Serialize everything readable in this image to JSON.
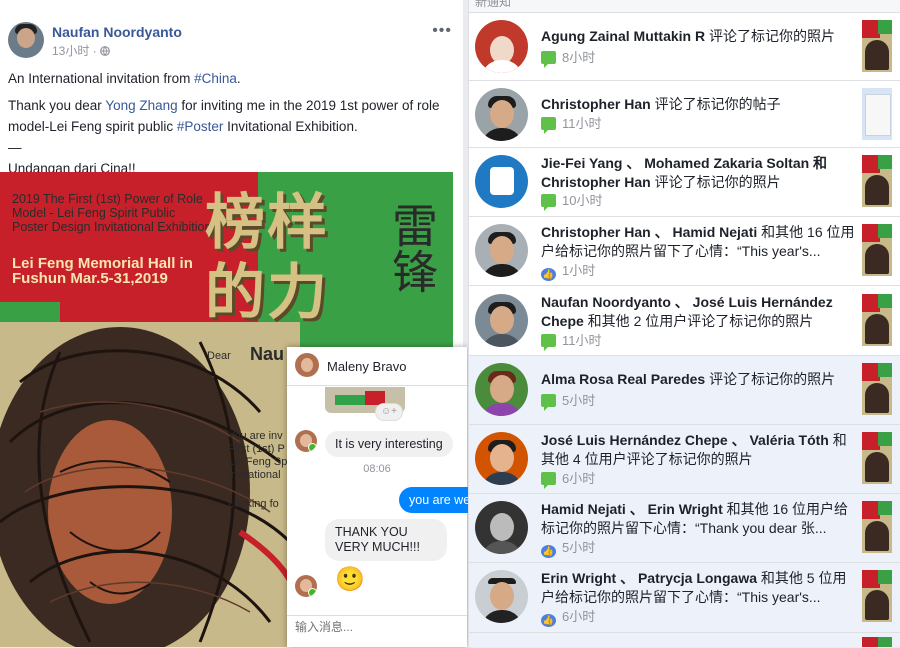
{
  "post": {
    "author": "Naufan Noordyanto",
    "time": "13小时",
    "privacy_icon": "globe-icon",
    "more": "•••",
    "line1_pre": "An International invitation from ",
    "line1_tag": "#China",
    "line1_post": ".",
    "line2_pre": "Thank you dear ",
    "line2_name": "Yong Zhang",
    "line2_mid": " for inviting me in the 2019 1st power of role model-Lei Feng spirit public ",
    "line2_tag": "#Poster",
    "line2_post": " Invitational Exhibition.",
    "line3": "—",
    "line4": "Undangan dari Cina!!"
  },
  "poster": {
    "title_en": "2019 The First (1st) Power of Role Model - Lei Feng Spirit Public Poster Design Invitational Exhibition",
    "hall": "Lei Feng Memorial Hall in Fushun Mar.5-31,2019",
    "title_cn": "榜样的力量",
    "calligraphy": "雷锋",
    "dear": "Dear",
    "name_partial": "Nau",
    "invite_text": "You are inv First (1st) P Lei Feng Sp Invitational",
    "looking": "Looking fo",
    "colors": {
      "red": "#c8202a",
      "green": "#3aa046",
      "beige": "#c8b98a",
      "gold": "#d6c184"
    }
  },
  "chat": {
    "contact": "Maleny Bravo",
    "msg_in_1": "It is very interesting",
    "time": "08:06",
    "msg_out_1": "you are we",
    "msg_in_2": "THANK YOU VERY MUCH!!!",
    "emoji": "🙂",
    "input_placeholder": "输入消息..."
  },
  "notifications": {
    "header": "新通知",
    "items": [
      {
        "actors": "Agung Zainal Muttakin R",
        "action": " 评论了标记你的照片",
        "time": "8小时",
        "type": "comment"
      },
      {
        "actors": "Christopher Han",
        "action": " 评论了标记你的帖子",
        "time": "11小时",
        "type": "comment"
      },
      {
        "actors": "Jie-Fei Yang 、 Mohamed Zakaria Soltan 和 Christopher Han",
        "action": " 评论了标记你的照片",
        "time": "10小时",
        "type": "comment"
      },
      {
        "actors": "Christopher Han 、 Hamid Nejati",
        "action": " 和其他 16 位用户给标记你的照片留下了心情：“This year's...",
        "time": "1小时",
        "type": "like"
      },
      {
        "actors": "Naufan Noordyanto 、 José Luis Hernández Chepe",
        "action": " 和其他 2 位用户评论了标记你的照片",
        "time": "11小时",
        "type": "comment"
      },
      {
        "actors": "Alma Rosa Real Paredes",
        "action": " 评论了标记你的照片",
        "time": "5小时",
        "type": "comment"
      },
      {
        "actors": "José Luis Hernández Chepe 、 Valéria Tóth",
        "action": " 和其他 4 位用户评论了标记你的照片",
        "time": "6小时",
        "type": "comment"
      },
      {
        "actors": "Hamid Nejati 、 Erin Wright",
        "action": " 和其他 16 位用户给标记你的照片留下心情：“Thank you dear 张...",
        "time": "5小时",
        "type": "like"
      },
      {
        "actors": "Erin Wright 、 Patrycja Longawa",
        "action": " 和其他 5 位用户给标记你的照片留下了心情：“This year's...",
        "time": "6小时",
        "type": "like"
      }
    ]
  }
}
